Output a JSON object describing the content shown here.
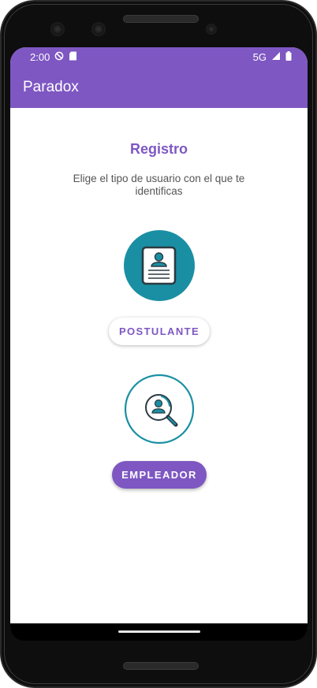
{
  "status_bar": {
    "time": "2:00",
    "network": "5G"
  },
  "app_bar": {
    "title": "Paradox"
  },
  "registro": {
    "title": "Registro",
    "subtitle": "Elige el tipo de usuario con el que te identificas",
    "options": [
      {
        "label": "POSTULANTE",
        "icon": "resume-icon",
        "style": "filled-circle"
      },
      {
        "label": "EMPLEADOR",
        "icon": "person-search-icon",
        "style": "outlined-circle"
      }
    ]
  },
  "colors": {
    "primary": "#7e57c2",
    "icon_teal": "#1a8fa3",
    "background": "#ffffff"
  }
}
